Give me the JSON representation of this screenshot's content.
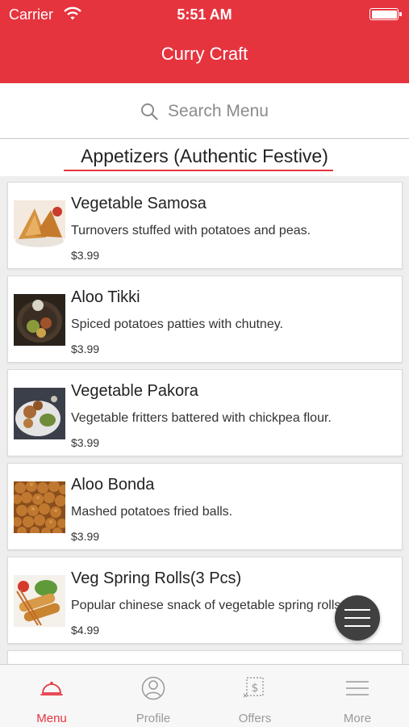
{
  "status_bar": {
    "carrier": "Carrier",
    "time": "5:51 AM"
  },
  "header": {
    "title": "Curry Craft"
  },
  "search": {
    "placeholder": "Search Menu"
  },
  "section": {
    "title": "Appetizers (Authentic Festive)"
  },
  "colors": {
    "brand": "#e6343f",
    "fab": "#404040",
    "inactive": "#9a9a9a"
  },
  "items": [
    {
      "name": "Vegetable Samosa",
      "description": "Turnovers stuffed with potatoes and peas.",
      "price": "$3.99",
      "image": "samosa-photo"
    },
    {
      "name": "Aloo Tikki",
      "description": "Spiced potatoes patties with chutney.",
      "price": "$3.99",
      "image": "aloo-tikki-photo"
    },
    {
      "name": "Vegetable Pakora",
      "description": "Vegetable fritters battered with chickpea flour.",
      "price": "$3.99",
      "image": "pakora-photo"
    },
    {
      "name": "Aloo Bonda",
      "description": "Mashed potatoes fried balls.",
      "price": "$3.99",
      "image": "aloo-bonda-photo"
    },
    {
      "name": "Veg Spring Rolls(3 Pcs)",
      "description": "Popular chinese snack of vegetable spring rolls.",
      "price": "$4.99",
      "image": "spring-rolls-photo"
    }
  ],
  "tabs": [
    {
      "label": "Menu",
      "icon": "cloche-icon",
      "active": true
    },
    {
      "label": "Profile",
      "icon": "profile-icon",
      "active": false
    },
    {
      "label": "Offers",
      "icon": "offers-icon",
      "active": false
    },
    {
      "label": "More",
      "icon": "more-icon",
      "active": false
    }
  ]
}
